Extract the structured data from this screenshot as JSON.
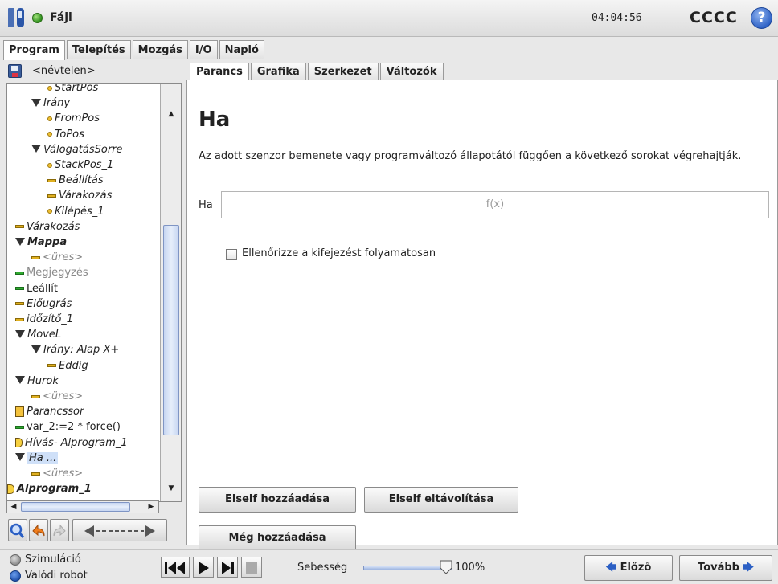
{
  "titlebar": {
    "file_label": "Fájl",
    "clock": "04:04:56",
    "robot_name": "CCCC",
    "help_symbol": "?"
  },
  "main_tabs": [
    "Program",
    "Telepítés",
    "Mozgás",
    "I/O",
    "Napló"
  ],
  "program": {
    "name": "<névtelen>"
  },
  "tree": [
    {
      "label": "StartPos",
      "icon": "dot",
      "style": "italic"
    },
    {
      "label": "Irány",
      "icon": "triangle",
      "style": "italic"
    },
    {
      "label": "FromPos",
      "icon": "dot",
      "style": "italic"
    },
    {
      "label": "ToPos",
      "icon": "dot",
      "style": "italic"
    },
    {
      "label": "VálogatásSorre",
      "icon": "triangle",
      "style": "italic"
    },
    {
      "label": "StackPos_1",
      "icon": "dot",
      "style": "italic"
    },
    {
      "label": "Beállítás",
      "icon": "bar",
      "style": "italic"
    },
    {
      "label": "Várakozás",
      "icon": "bar",
      "style": "italic"
    },
    {
      "label": "Kilépés_1",
      "icon": "dot",
      "style": "italic"
    },
    {
      "label": "Várakozás",
      "icon": "bar",
      "style": "italic"
    },
    {
      "label": "Mappa",
      "icon": "triangle",
      "style": "bold-italic"
    },
    {
      "label": "<üres>",
      "icon": "bar",
      "style": "gray"
    },
    {
      "label": "Megjegyzés",
      "icon": "green-bar",
      "style": "gray-plain"
    },
    {
      "label": "Leállít",
      "icon": "green-bar",
      "style": "plain"
    },
    {
      "label": "Előugrás",
      "icon": "bar",
      "style": "italic"
    },
    {
      "label": "időzítő_1",
      "icon": "bar",
      "style": "italic"
    },
    {
      "label": "MoveL",
      "icon": "triangle",
      "style": "italic"
    },
    {
      "label": "Irány: Alap X+",
      "icon": "triangle",
      "style": "italic"
    },
    {
      "label": "Eddig",
      "icon": "bar",
      "style": "italic"
    },
    {
      "label": "Hurok",
      "icon": "triangle",
      "style": "italic"
    },
    {
      "label": "<üres>",
      "icon": "bar",
      "style": "gray"
    },
    {
      "label": "Parancssor",
      "icon": "doc",
      "style": "italic"
    },
    {
      "label": "var_2:=2 * force()",
      "icon": "green-bar",
      "style": "plain"
    },
    {
      "label": "Hívás- Alprogram_1",
      "icon": "call",
      "style": "italic"
    },
    {
      "label": "Ha ...",
      "icon": "triangle",
      "style": "selected"
    },
    {
      "label": "<üres>",
      "icon": "bar",
      "style": "gray"
    },
    {
      "label": "Alprogram_1",
      "icon": "call",
      "style": "bold-italic"
    }
  ],
  "toolbar": {
    "search_icon": "magnifier-icon",
    "undo_icon": "undo-arrow-icon",
    "redo_icon": "redo-arrow-icon",
    "move_icon": "move-arrows-icon"
  },
  "sub_tabs": [
    "Parancs",
    "Grafika",
    "Szerkezet",
    "Változók"
  ],
  "command": {
    "title": "Ha",
    "description": "Az adott szenzor bemenete vagy programváltozó állapotától függően a következő sorokat végrehajtják.",
    "ha_label": "Ha",
    "expression_placeholder": "f(x)",
    "continuous_label": "Ellenőrizze a kifejezést folyamatosan",
    "continuous_checked": false,
    "add_elseif": "Elself hozzáadása",
    "remove_elseif": "Elself eltávolítása",
    "add_else": "Még hozzáadása"
  },
  "bottom": {
    "simulation": "Szimuláció",
    "real_robot": "Valódi robot",
    "speed_label": "Sebesség",
    "speed_value": "100%",
    "speed_fraction": 1.0,
    "prev": "Előző",
    "next": "Tovább"
  },
  "colors": {
    "accent": "#2b5fc4",
    "selection": "#cfe0f8",
    "node_yellow": "#e0b020",
    "node_green": "#2faa30"
  }
}
